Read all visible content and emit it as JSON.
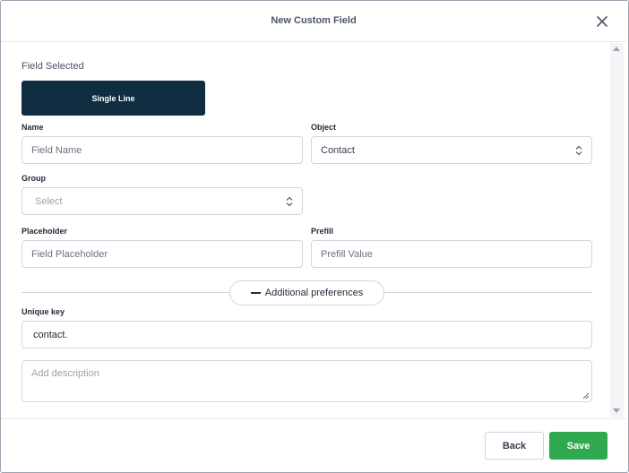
{
  "dialog": {
    "title": "New Custom Field"
  },
  "field_selected": {
    "label": "Field Selected",
    "type": "Single Line"
  },
  "form": {
    "name": {
      "label": "Name",
      "placeholder": "Field Name"
    },
    "object": {
      "label": "Object",
      "value": "Contact"
    },
    "group": {
      "label": "Group",
      "placeholder": "Select"
    },
    "placeholder": {
      "label": "Placeholder",
      "placeholder": "Field Placeholder"
    },
    "prefill": {
      "label": "Prefill",
      "placeholder": "Prefill Value"
    },
    "additional_preferences": "Additional preferences",
    "unique_key": {
      "label": "Unique key",
      "value": "contact."
    },
    "description": {
      "placeholder": "Add description"
    }
  },
  "footer": {
    "back_label": "Back",
    "save_label": "Save"
  },
  "colors": {
    "chip_bg": "#102d41",
    "save_bg": "#2fa84f"
  }
}
